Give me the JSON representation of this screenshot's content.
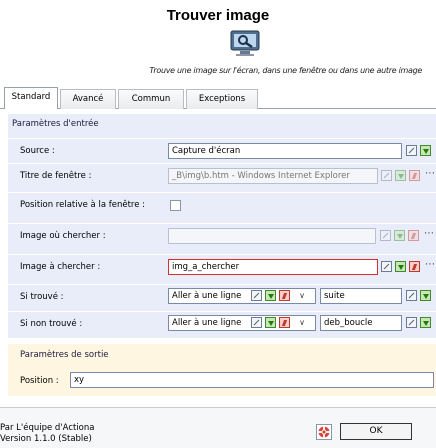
{
  "header": {
    "title": "Trouver image",
    "subtitle": "Trouve une image sur l'écran, dans une fenêtre ou dans une autre image",
    "icon": "screen-capture-icon"
  },
  "tabs": [
    {
      "label": "Standard",
      "active": true
    },
    {
      "label": "Avancé",
      "active": false
    },
    {
      "label": "Commun",
      "active": false
    },
    {
      "label": "Exceptions",
      "active": false
    }
  ],
  "input_params": {
    "group_label": "Paramètres d'entrée",
    "source": {
      "label": "Source :",
      "value": "Capture d'écran"
    },
    "window_title": {
      "label": "Titre de fenêtre :",
      "value": "_B\\img\\b.htm - Windows Internet Explorer"
    },
    "relative_position": {
      "label": "Position relative à la fenêtre :",
      "checked": false
    },
    "search_in_image": {
      "label": "Image où chercher :",
      "value": ""
    },
    "image_to_find": {
      "label": "Image à chercher :",
      "value": "img_a_chercher"
    },
    "if_found": {
      "label": "Si trouvé :",
      "action": "Aller à une ligne",
      "target": "suite"
    },
    "if_not_found": {
      "label": "Si non trouvé :",
      "action": "Aller à une ligne",
      "target": "deb_boucle"
    }
  },
  "output_params": {
    "group_label": "Paramètres de sortie",
    "position": {
      "label": "Position :",
      "value": "xy"
    }
  },
  "footer": {
    "credit_line1": "Par L'équipe d'Actiona",
    "credit_line2": "Version 1.1.0 (Stable)",
    "ok_label": "OK"
  },
  "colors": {
    "input_panel_bg": "#e8edf9",
    "output_panel_bg": "#fff6e2",
    "highlight_border": "#d8312a"
  }
}
